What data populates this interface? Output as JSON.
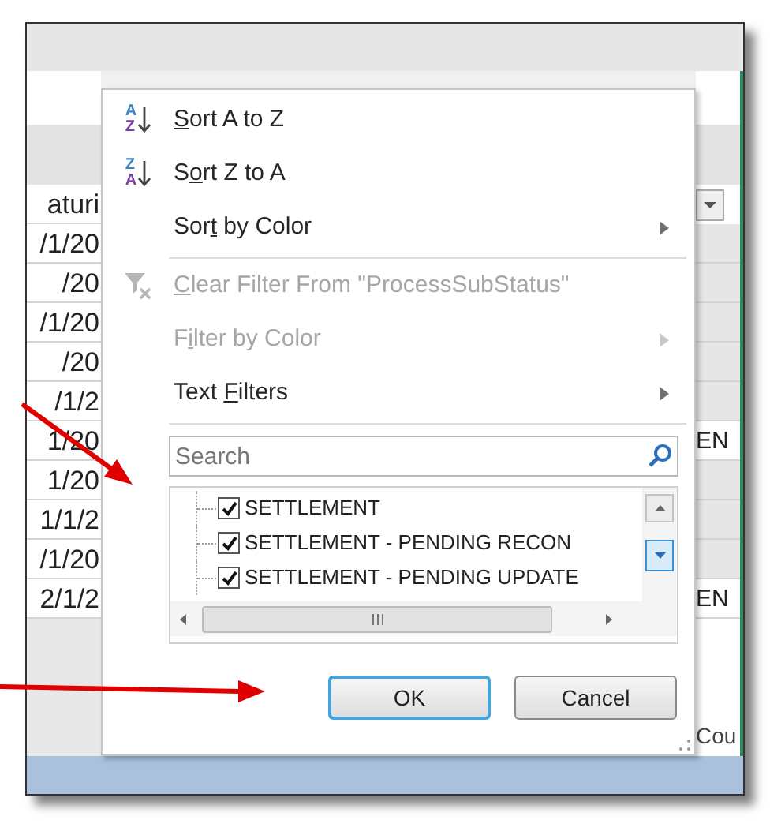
{
  "sheet": {
    "left_cells": [
      "aturi",
      "/1/20",
      "/20",
      "/1/20",
      "/20",
      "/1/2",
      "1/20",
      "1/20",
      "1/1/2",
      "/1/20",
      "2/1/2"
    ],
    "right_cells": [
      {
        "kind": "dropdown"
      },
      {
        "kind": "empty"
      },
      {
        "kind": "empty"
      },
      {
        "kind": "empty"
      },
      {
        "kind": "empty"
      },
      {
        "kind": "empty"
      },
      {
        "kind": "text",
        "text": "EN"
      },
      {
        "kind": "empty"
      },
      {
        "kind": "empty"
      },
      {
        "kind": "empty"
      },
      {
        "kind": "text",
        "text": "EN"
      }
    ],
    "status_text": "Cou"
  },
  "menu": {
    "items": [
      {
        "kind": "sort",
        "icon_letters": [
          "A",
          "Z"
        ],
        "label_parts": [
          {
            "text": "S",
            "underlined": true
          },
          {
            "text": "ort A to Z",
            "underlined": false
          }
        ],
        "disabled": false,
        "submenu": false
      },
      {
        "kind": "sort",
        "icon_letters": [
          "Z",
          "A"
        ],
        "label_parts": [
          {
            "text": "S",
            "underlined": false
          },
          {
            "text": "o",
            "underlined": true
          },
          {
            "text": "rt Z to A",
            "underlined": false
          }
        ],
        "disabled": false,
        "submenu": false
      },
      {
        "kind": "command",
        "label_parts": [
          {
            "text": "Sor",
            "underlined": false
          },
          {
            "text": "t",
            "underlined": true
          },
          {
            "text": " by Color",
            "underlined": false
          }
        ],
        "disabled": false,
        "submenu": true
      },
      {
        "kind": "separator"
      },
      {
        "kind": "clear-filter",
        "label_parts": [
          {
            "text": "C",
            "underlined": true
          },
          {
            "text": "lear Filter From \"ProcessSubStatus\"",
            "underlined": false
          }
        ],
        "disabled": true,
        "submenu": false
      },
      {
        "kind": "command",
        "label_parts": [
          {
            "text": "F",
            "underlined": false
          },
          {
            "text": "i",
            "underlined": true
          },
          {
            "text": "lter by Color",
            "underlined": false
          }
        ],
        "disabled": true,
        "submenu": true
      },
      {
        "kind": "command",
        "label_parts": [
          {
            "text": "Text ",
            "underlined": false
          },
          {
            "text": "F",
            "underlined": true
          },
          {
            "text": "ilters",
            "underlined": false
          }
        ],
        "disabled": false,
        "submenu": true
      },
      {
        "kind": "separator"
      }
    ],
    "search": {
      "placeholder": "Search"
    },
    "values": [
      {
        "label": "SETTLEMENT",
        "checked": true
      },
      {
        "label": "SETTLEMENT - PENDING RECON",
        "checked": true
      },
      {
        "label": "SETTLEMENT - PENDING UPDATE",
        "checked": true
      }
    ],
    "buttons": [
      {
        "label": "OK",
        "default": true
      },
      {
        "label": "Cancel",
        "default": false
      }
    ]
  }
}
